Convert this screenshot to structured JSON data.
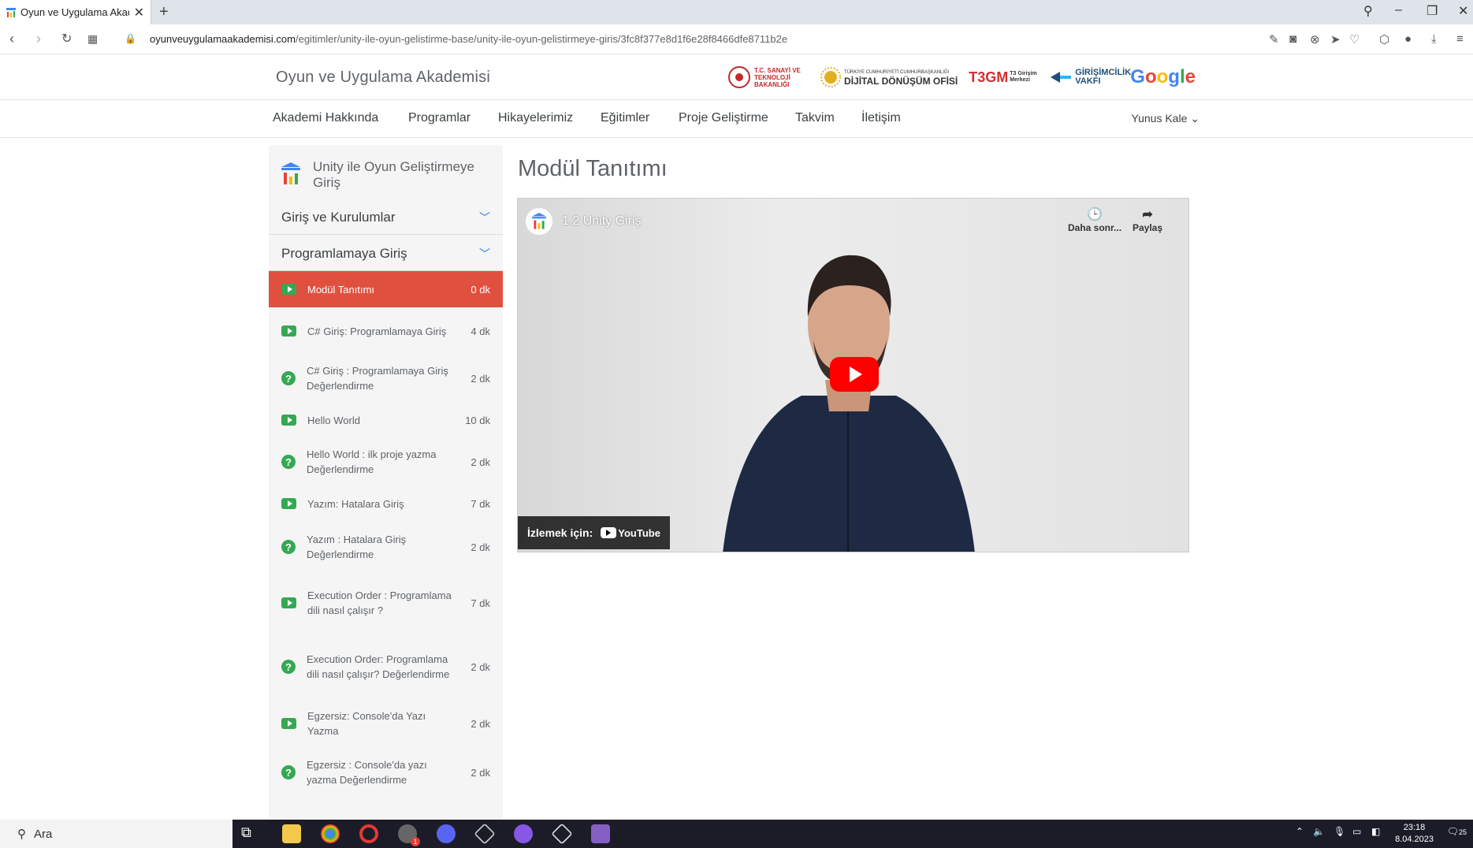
{
  "browser": {
    "tab_title": "Oyun ve Uygulama Akaden",
    "url_host": "oyunveuygulamaakademisi.com",
    "url_path": "/egitimler/unity-ile-oyun-gelistirme-base/unity-ile-oyun-gelistirmeye-giris/3fc8f377e8d1f6e28f8466dfe8711b2e"
  },
  "header": {
    "site_title": "Oyun ve Uygulama Akademisi",
    "logo_tsb": "T.C. SANAYİ VE TEKNOLOJİ BAKANLIĞI",
    "logo_ddo_small": "TÜRKİYE CUMHURİYETİ CUMHURBAŞKANLIĞI",
    "logo_ddo": "DİJİTAL DÖNÜŞÜM OFİSİ",
    "logo_t3": "T3GM",
    "logo_t3_sub": "T3 Girişim Merkezi",
    "logo_gv": "GİRİŞİMCİLİK VAKFI",
    "logo_google": "Google"
  },
  "nav": {
    "items": [
      "Akademi Hakkında",
      "Programlar",
      "Hikayelerimiz",
      "Eğitimler",
      "Proje Geliştirme",
      "Takvim",
      "İletişim"
    ],
    "user": "Yunus Kale"
  },
  "sidebar": {
    "course_title": "Unity ile Oyun Geliştirmeye Giriş",
    "sections": [
      "Giriş ve Kurulumlar",
      "Programlamaya Giriş"
    ],
    "lessons": [
      {
        "label": "Modül Tanıtımı",
        "duration": "0 dk",
        "type": "video"
      },
      {
        "label": "C# Giriş: Programlamaya Giriş",
        "duration": "4 dk",
        "type": "video"
      },
      {
        "label": "C# Giriş : Programlamaya Giriş Değerlendirme",
        "duration": "2 dk",
        "type": "quiz"
      },
      {
        "label": "Hello World",
        "duration": "10 dk",
        "type": "video"
      },
      {
        "label": "Hello World : ilk proje yazma Değerlendirme",
        "duration": "2 dk",
        "type": "quiz"
      },
      {
        "label": "Yazım: Hatalara Giriş",
        "duration": "7 dk",
        "type": "video"
      },
      {
        "label": "Yazım : Hatalara Giriş Değerlendirme",
        "duration": "2 dk",
        "type": "quiz"
      },
      {
        "label": "Execution Order : Programlama dili nasıl çalışır ?",
        "duration": "7 dk",
        "type": "video"
      },
      {
        "label": "Execution Order: Programlama dili nasıl çalışır? Değerlendirme",
        "duration": "2 dk",
        "type": "quiz"
      },
      {
        "label": "Egzersiz: Console'da Yazı Yazma",
        "duration": "2 dk",
        "type": "video"
      },
      {
        "label": "Egzersiz : Console'da yazı yazma Değerlendirme",
        "duration": "2 dk",
        "type": "quiz"
      }
    ]
  },
  "main": {
    "page_title": "Modül Tanıtımı",
    "video": {
      "title": "1.2 Unity Giriş",
      "watch_later": "Daha sonr...",
      "share": "Paylaş",
      "watch_on": "İzlemek için:",
      "youtube": "YouTube"
    }
  },
  "taskbar": {
    "search_placeholder": "Ara",
    "time": "23:18",
    "date": "8.04.2023",
    "notif_count": "25",
    "badge": "1"
  },
  "colors": {
    "active_lesson": "#e0503f",
    "accent_green": "#34a853",
    "link_blue": "#1a73e8"
  }
}
